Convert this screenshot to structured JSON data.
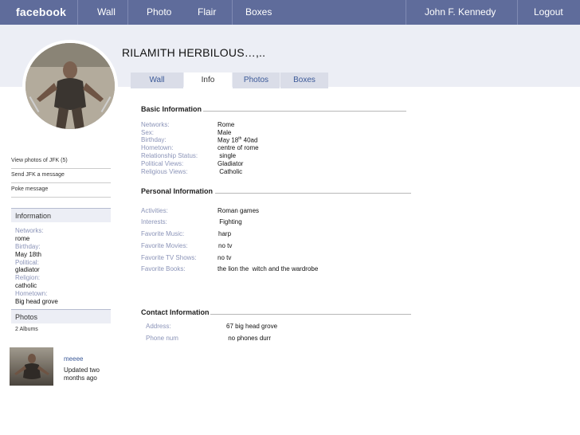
{
  "topbar": {
    "logo": "facebook",
    "nav": [
      "Wall",
      "Photo",
      "Flair",
      "Boxes"
    ],
    "user": "John F. Kennedy",
    "logout": "Logout"
  },
  "profile": {
    "name": "RILAMITH HERBILOUS…,..",
    "tabs": [
      "Wall",
      "Info",
      "Photos",
      "Boxes"
    ]
  },
  "left": {
    "links": [
      "View photos of JFK (5)",
      "Send JFK a message",
      "Poke message"
    ],
    "info_header": "Information",
    "info": [
      {
        "label": "Networks:",
        "value": "rome"
      },
      {
        "label": "Birthday:",
        "value": "May 18th"
      },
      {
        "label": "Political:",
        "value": "gladiator"
      },
      {
        "label": "Religion:",
        "value": "catholic"
      },
      {
        "label": "Hometown:",
        "value": "Big head grove"
      }
    ],
    "photos_header": "Photos",
    "albums": "2 Albums",
    "status_name": "meeee",
    "status_time": "Updated two months ago"
  },
  "basic": {
    "header": "Basic Information",
    "fields": [
      {
        "label": "Networks:",
        "value": "Rome"
      },
      {
        "label": "Sex:",
        "value": "Male"
      },
      {
        "label": "Birthday:",
        "value": "May 18",
        "sup": "th",
        "value_after": " 40ad"
      },
      {
        "label": "Hometown:",
        "value": "centre of rome"
      },
      {
        "label": "Relationship Status:",
        "value": " single"
      },
      {
        "label": "Political Views:",
        "value": "Gladiator"
      },
      {
        "label": "Religious Views:",
        "value": " Catholic"
      }
    ]
  },
  "personal": {
    "header": "Personal Information",
    "fields": [
      {
        "label": "Activities:",
        "value": "Roman games"
      },
      {
        "label": "Interests:",
        "value": " Fighting"
      },
      {
        "label": "Favorite Music:",
        "value": "harp"
      },
      {
        "label": "Favorite Movies:",
        "value": "no tv"
      },
      {
        "label": "Favorite TV Shows:",
        "value": "no tv"
      },
      {
        "label": "Favorite Books:",
        "value": "the lion the  witch and the wardrobe"
      }
    ]
  },
  "contact": {
    "header": "Contact Information",
    "fields": [
      {
        "label": "Address:",
        "value": "67 big head grove"
      },
      {
        "label": "Phone num",
        "value": " no phones durr"
      }
    ]
  },
  "colors": {
    "topbar": "#5f6c9b",
    "subbar": "#eceef5",
    "label": "#8b94b8",
    "link": "#3b5998"
  }
}
